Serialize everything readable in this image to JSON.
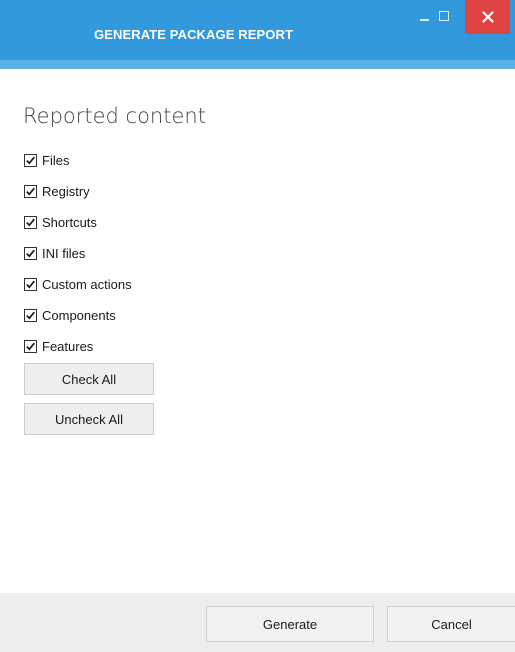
{
  "window": {
    "title": "GENERATE PACKAGE REPORT",
    "controls": {
      "minimize_icon": "minimize-icon",
      "maximize_icon": "maximize-icon",
      "close_icon": "close-icon",
      "close_glyph": "✕"
    }
  },
  "section": {
    "title": "Reported content"
  },
  "checklist": {
    "items": [
      {
        "label": "Files",
        "checked": true
      },
      {
        "label": "Registry",
        "checked": true
      },
      {
        "label": "Shortcuts",
        "checked": true
      },
      {
        "label": "INI files",
        "checked": true
      },
      {
        "label": "Custom actions",
        "checked": true
      },
      {
        "label": "Components",
        "checked": true
      },
      {
        "label": "Features",
        "checked": true
      }
    ]
  },
  "buttons": {
    "check_all": "Check All",
    "uncheck_all": "Uncheck All",
    "generate": "Generate",
    "cancel": "Cancel"
  },
  "colors": {
    "title_bar": "#3399dd",
    "title_bar_strip": "#5ab0e6",
    "close_button": "#e04343",
    "footer": "#eeeeee"
  }
}
